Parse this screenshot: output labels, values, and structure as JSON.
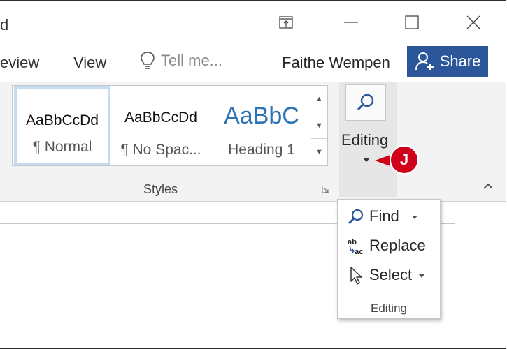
{
  "window": {
    "title_fragment": "d"
  },
  "tabs": [
    "eview",
    "View"
  ],
  "tell_me": {
    "placeholder": "Tell me..."
  },
  "user": {
    "name": "Faithe Wempen"
  },
  "share": {
    "label": "Share"
  },
  "ribbon": {
    "styles_group": {
      "label": "Styles",
      "items": [
        {
          "sample": "AaBbCcDd",
          "name": "¶ Normal",
          "selected": true
        },
        {
          "sample": "AaBbCcDd",
          "name": "¶ No Spac...",
          "selected": false
        },
        {
          "sample": "AaBbC",
          "name": "Heading 1",
          "selected": false
        }
      ]
    },
    "editing_group": {
      "label": "Editing",
      "callout": "J"
    }
  },
  "editing_menu": {
    "items": [
      {
        "label": "Find",
        "icon": "search-icon",
        "has_dropdown": true
      },
      {
        "label": "Replace",
        "icon": "replace-icon",
        "has_dropdown": false
      },
      {
        "label": "Select",
        "icon": "cursor-arrow-icon",
        "has_dropdown": true
      }
    ],
    "footer": "Editing"
  },
  "colors": {
    "accent": "#2b579a",
    "callout": "#d0021b",
    "heading_blue": "#2e74b5"
  }
}
